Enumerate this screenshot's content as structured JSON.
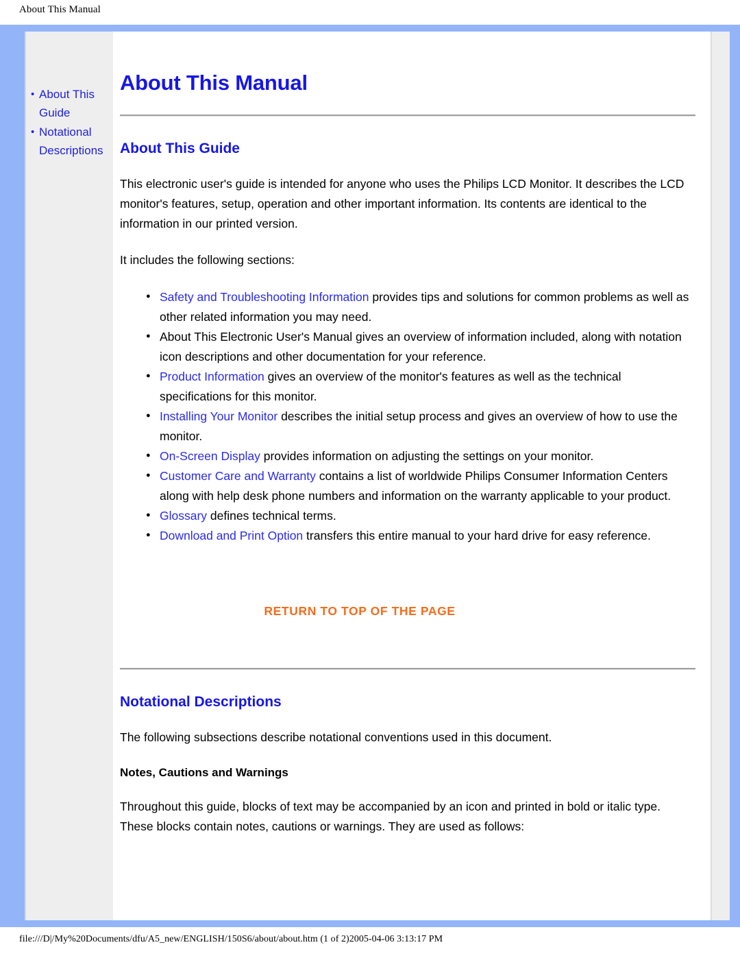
{
  "browser": {
    "header_title": "About This Manual",
    "footer_path": "file:///D|/My%20Documents/dfu/A5_new/ENGLISH/150S6/about/about.htm (1 of 2)2005-04-06 3:13:17 PM"
  },
  "colors": {
    "frame_blue": "#93b4f8",
    "sidebar_gray": "#eeeeee",
    "heading_blue": "#1616e8",
    "link_blue": "#2a2aee",
    "return_orange": "#f26d1d",
    "rule_gray": "#9e9e9e"
  },
  "sidebar": {
    "items": [
      {
        "label": "About This Guide"
      },
      {
        "label": "Notational Descriptions"
      }
    ]
  },
  "main": {
    "title": "About This Manual",
    "section1": {
      "heading": "About This Guide",
      "paragraph1": "This electronic user's guide is intended for anyone who uses the Philips LCD Monitor. It describes the LCD monitor's features, setup, operation and other important information. Its contents are identical to the information in our printed version.",
      "paragraph2": "It includes the following sections:",
      "bullets": [
        {
          "link": "Safety and Troubleshooting Information",
          "text": " provides tips and solutions for common problems as well as other related information you may need."
        },
        {
          "link": "",
          "text": "About This Electronic User's Manual gives an overview of information included, along with notation icon descriptions and other documentation for your reference."
        },
        {
          "link": "Product Information",
          "text": " gives an overview of the monitor's features as well as the technical specifications for this monitor."
        },
        {
          "link": "Installing Your Monitor",
          "text": " describes the initial setup process and gives an overview of how to use the monitor."
        },
        {
          "link": "On-Screen Display",
          "text": " provides information on adjusting the settings on your monitor."
        },
        {
          "link": "Customer Care and Warranty",
          "text": " contains a list of worldwide Philips Consumer Information Centers along with help desk phone numbers and information on the warranty applicable to your product."
        },
        {
          "link": "Glossary",
          "text": " defines technical terms."
        },
        {
          "link": "Download and Print Option",
          "text": " transfers this entire manual to your hard drive for easy reference."
        }
      ],
      "return_top_label": "RETURN TO TOP OF THE PAGE"
    },
    "section2": {
      "heading": "Notational Descriptions",
      "paragraph1": "The following subsections describe notational conventions used in this document.",
      "subheading": "Notes, Cautions and Warnings",
      "paragraph2": "Throughout this guide, blocks of text may be accompanied by an icon and printed in bold or italic type. These blocks contain notes, cautions or warnings. They are used as follows:"
    }
  }
}
